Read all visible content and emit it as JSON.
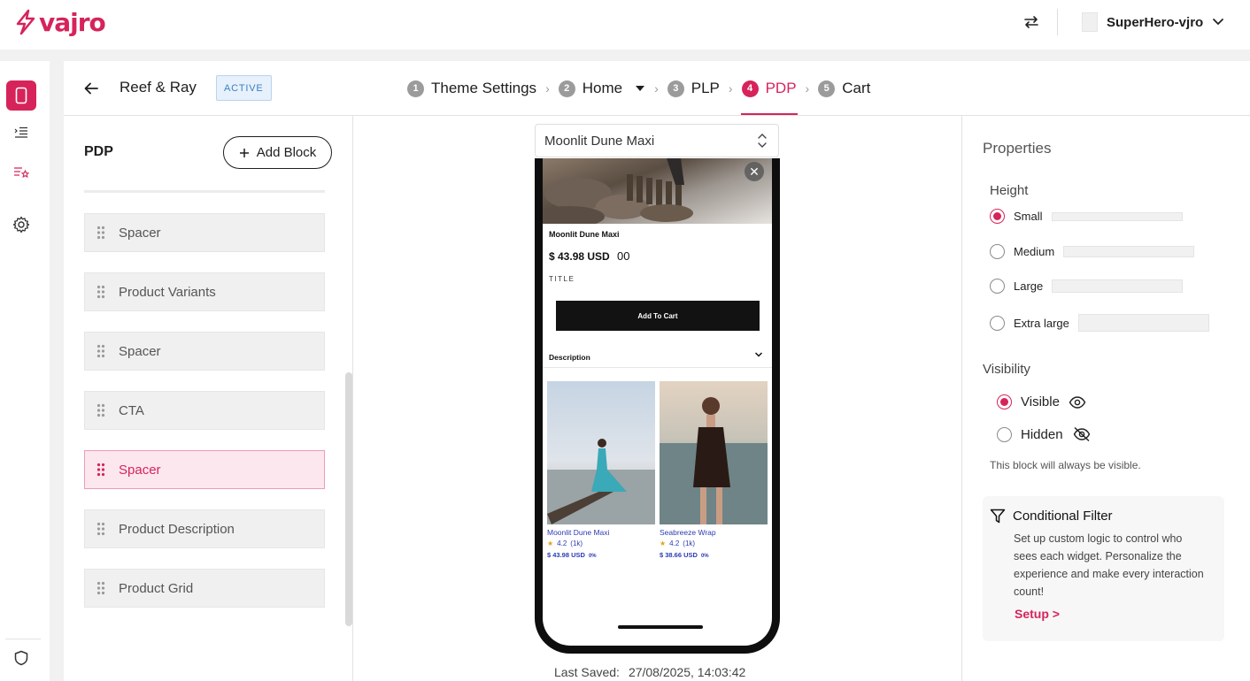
{
  "brand": {
    "logo_text": "vajro",
    "accent": "#d6245a"
  },
  "topbar": {
    "account_name": "SuperHero-vjro"
  },
  "header": {
    "store_name": "Reef & Ray",
    "status": "ACTIVE",
    "steps": [
      {
        "num": "1",
        "label": "Theme Settings"
      },
      {
        "num": "2",
        "label": "Home"
      },
      {
        "num": "3",
        "label": "PLP"
      },
      {
        "num": "4",
        "label": "PDP"
      },
      {
        "num": "5",
        "label": "Cart"
      }
    ],
    "active_step": "PDP"
  },
  "blocks_panel": {
    "title": "PDP",
    "add_block_label": "Add Block",
    "items": [
      {
        "label": "Spacer"
      },
      {
        "label": "Product Variants"
      },
      {
        "label": "Spacer"
      },
      {
        "label": "CTA"
      },
      {
        "label": "Spacer",
        "selected": true
      },
      {
        "label": "Product Description"
      },
      {
        "label": "Product Grid"
      }
    ]
  },
  "preview": {
    "selected_product": "Moonlit Dune Maxi",
    "phone": {
      "product_title": "Moonlit Dune Maxi",
      "price": "$ 43.98 USD",
      "price_extra": "00",
      "variant_label": "TITLE",
      "cta_label": "Add To Cart",
      "description_label": "Description",
      "grid": [
        {
          "name": "Moonlit Dune Maxi",
          "rating": "4.2",
          "reviews": "(1k)",
          "price": "$ 43.98 USD",
          "discount": "0%"
        },
        {
          "name": "Seabreeze Wrap",
          "rating": "4.2",
          "reviews": "(1k)",
          "price": "$ 38.66 USD",
          "discount": "0%"
        }
      ]
    },
    "last_saved_label": "Last Saved:",
    "last_saved_value": "27/08/2025, 14:03:42"
  },
  "properties": {
    "title": "Properties",
    "height_label": "Height",
    "height_options": [
      {
        "label": "Small",
        "selected": true
      },
      {
        "label": "Medium",
        "selected": false
      },
      {
        "label": "Large",
        "selected": false
      },
      {
        "label": "Extra large",
        "selected": false
      }
    ],
    "visibility_label": "Visibility",
    "visibility_options": [
      {
        "label": "Visible",
        "selected": true
      },
      {
        "label": "Hidden",
        "selected": false
      }
    ],
    "visibility_note": "This block will always be visible.",
    "filter": {
      "title": "Conditional Filter",
      "text": "Set up custom logic to control who sees each widget. Personalize the experience and make every interaction count!",
      "setup_label": "Setup >"
    }
  }
}
